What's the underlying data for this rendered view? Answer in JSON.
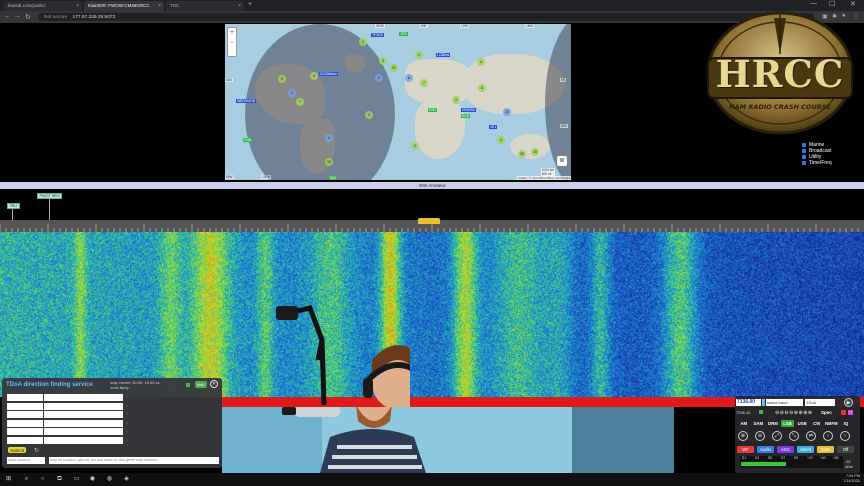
{
  "browser": {
    "tabs": [
      {
        "label": "kiwisdr.com/public/"
      },
      {
        "label": "KiwiSDR: FWOW-CM36GRCC"
      },
      {
        "label": "TOC"
      }
    ],
    "new_tab": "+",
    "address": "177.67.229.25:5073",
    "not_secure": "Not secure",
    "window_controls": [
      "—",
      "☐",
      "✕"
    ]
  },
  "map": {
    "zoom_in": "+",
    "zoom_out": "−",
    "labels_blue": [
      "TF3OZ",
      "LC8Bss",
      "ZX2/Maine",
      "WB/VK4HE",
      "VK6I/Sk",
      "JK1"
    ],
    "labels_green": [
      "JPD",
      "SC6",
      "F2D",
      "G3B",
      "SIG"
    ],
    "cluster_counts": [
      "2",
      "3",
      "37",
      "2",
      "6",
      "7",
      "2",
      "5",
      "4",
      "8",
      "22",
      "4",
      "5",
      "2",
      "7",
      "2",
      "3",
      "2",
      "15",
      "4",
      "20",
      "15"
    ],
    "axis_labels": [
      "60W",
      "120W",
      "0E/W",
      "60E",
      "120E",
      "180E",
      "60N",
      "0N",
      "60S"
    ],
    "scale": "1000 km",
    "scale2": "500 mi",
    "attribution": "Leaflet | © OpenStreetMap contributors"
  },
  "logo": {
    "main": "HRCC",
    "sub": "HAM RADIO CRASH COURSE"
  },
  "legend": [
    {
      "label": "Marine"
    },
    {
      "label": "Broadcast"
    },
    {
      "label": "Utility"
    },
    {
      "label": "Time/Freq"
    }
  ],
  "band": {
    "label": "40m Amateur"
  },
  "stations": [
    {
      "label": "PWOT 9RO"
    },
    {
      "label": "7RU"
    }
  ],
  "tdoa": {
    "title": "TDoA direction finding service",
    "map_center": "map center: 30.90, 15.90 zz",
    "result": "most likely:",
    "help": "help",
    "close": "✕",
    "submit": "Submit",
    "refresh": "↻",
    "zoom_placeholder": "basic zoom in",
    "location_placeholder": "Map ref location: type lat, lon and name or click green map markers",
    "rows": 6,
    "row_remove": "×"
  },
  "controls": {
    "frequency": "7136.00",
    "band_select": "select band",
    "ext_select": "TDoA",
    "play": "▶",
    "khz_label": "7036.45",
    "step_icons": [
      "⊖",
      "⊖",
      "⊖",
      "⊖",
      "⊕",
      "⊕",
      "⊕",
      "⊕"
    ],
    "spec": "Spec",
    "modes": [
      "AM",
      "SAM",
      "DRM",
      "LSB",
      "USB",
      "CW",
      "NBFM",
      "IQ"
    ],
    "active_mode": "LSB",
    "tools": [
      "⊕",
      "⊖",
      "⤢",
      "⤡",
      "⇄",
      "‹",
      "›"
    ],
    "function_buttons": [
      {
        "label": "WF",
        "color": "#e03a3a"
      },
      {
        "label": "Audio",
        "color": "#3a7ce0"
      },
      {
        "label": "AGC",
        "color": "#7b3ae0"
      },
      {
        "label": "Users",
        "color": "#3ab0e0"
      },
      {
        "label": "Stats",
        "color": "#e0c03a"
      },
      {
        "label": "Off",
        "color": "#444"
      }
    ],
    "dbm_ticks": [
      "S1",
      "S3",
      "S5",
      "S7",
      "S9",
      "+20",
      "+40",
      "+60"
    ],
    "dbm_unit": "dBm",
    "dbm_value": "-62",
    "signal_level": 0.45
  },
  "taskbar": {
    "time": "7:04 PM",
    "date": "7/14/2021"
  },
  "colors": {
    "accent_blue": "#2f7cf0",
    "red_bar": "#e01a1a",
    "passband": "#e6c230"
  }
}
